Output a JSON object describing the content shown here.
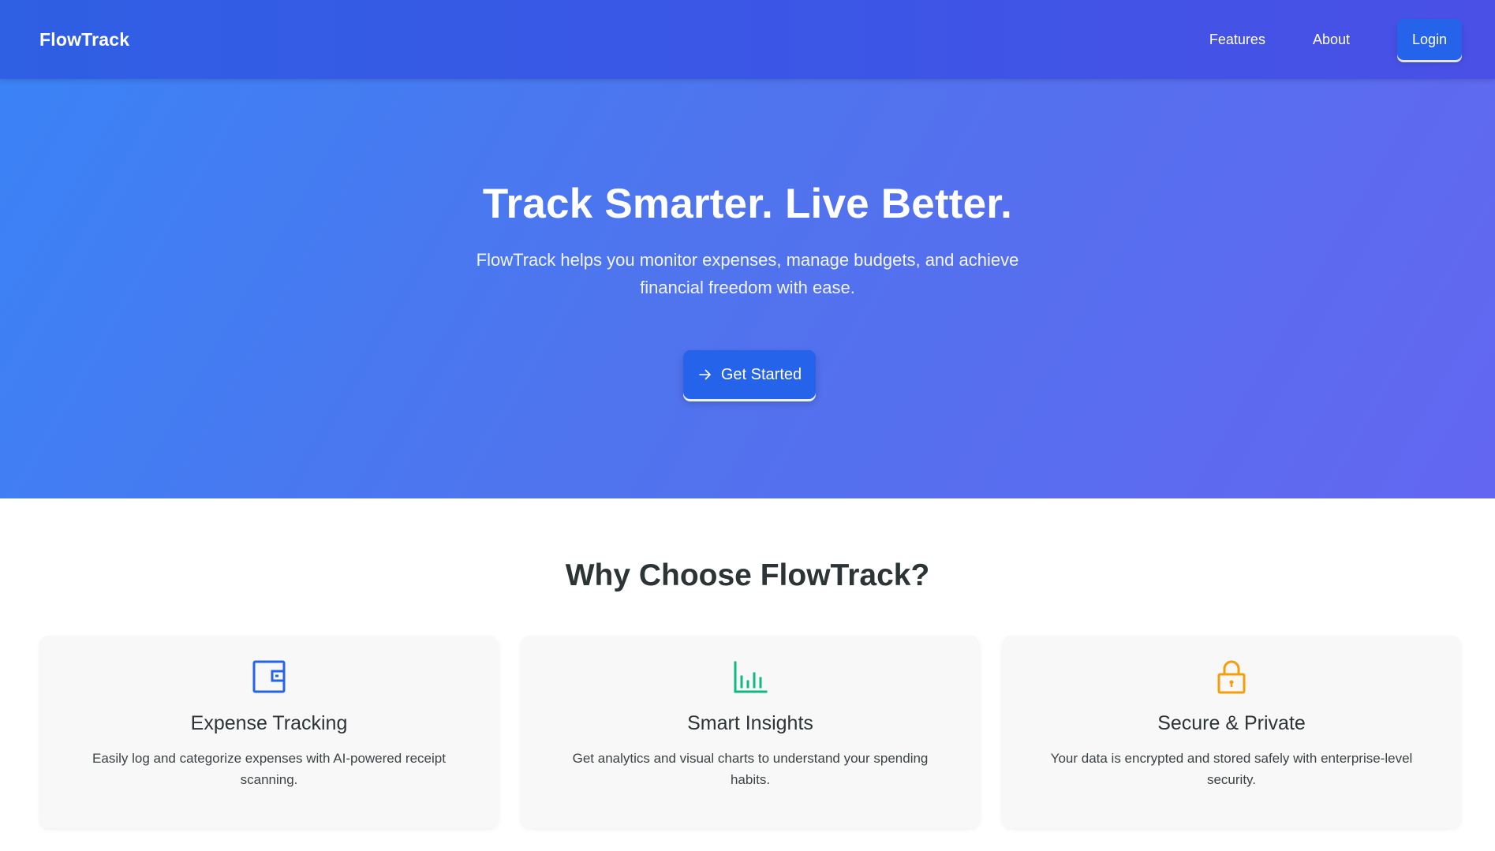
{
  "header": {
    "brand": "FlowTrack",
    "nav": {
      "features": "Features",
      "about": "About",
      "login": "Login"
    }
  },
  "hero": {
    "title": "Track Smarter. Live Better.",
    "subtitle": "FlowTrack helps you monitor expenses, manage budgets, and achieve financial freedom with ease.",
    "cta": "Get Started",
    "cta_icon": "arrow-right-icon"
  },
  "features": {
    "title": "Why Choose FlowTrack?",
    "cards": [
      {
        "icon": "wallet-icon",
        "icon_color": "#2563eb",
        "title": "Expense Tracking",
        "description": "Easily log and categorize expenses with AI-powered receipt scanning."
      },
      {
        "icon": "bar-chart-icon",
        "icon_color": "#10b981",
        "title": "Smart Insights",
        "description": "Get analytics and visual charts to understand your spending habits."
      },
      {
        "icon": "lock-icon",
        "icon_color": "#f59e0b",
        "title": "Secure & Private",
        "description": "Your data is encrypted and stored safely with enterprise-level security."
      }
    ]
  },
  "colors": {
    "header_gradient": [
      "#2f5fe3",
      "#4a50e6"
    ],
    "hero_gradient": [
      "#3b82f6",
      "#6366f1"
    ],
    "button": "#2563eb"
  }
}
